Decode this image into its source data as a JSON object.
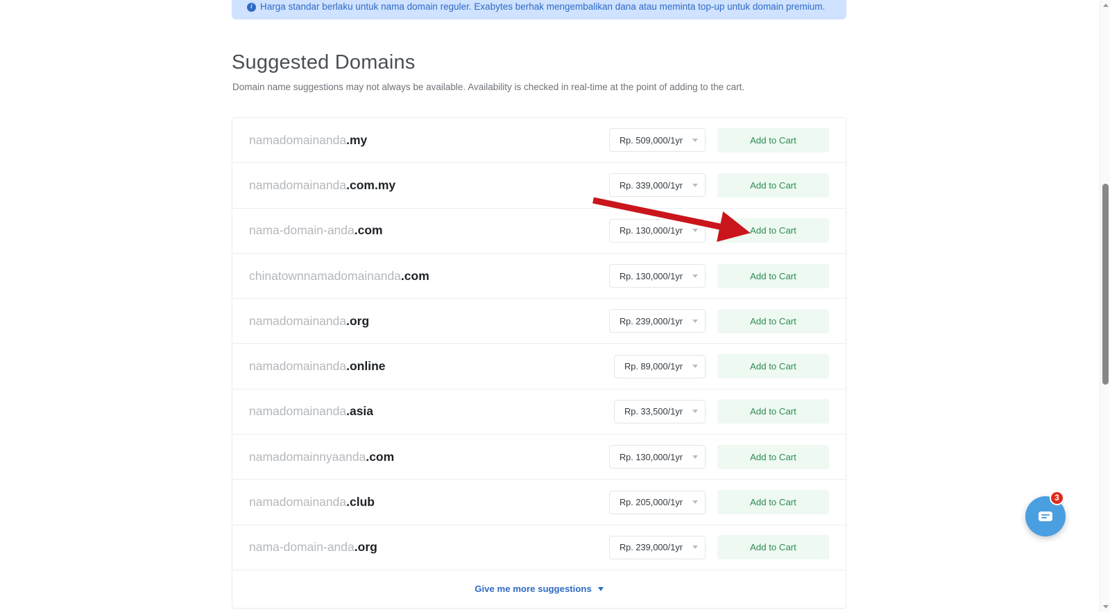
{
  "banner": {
    "icon": "info-circle-icon",
    "text": "Harga standar berlaku untuk nama domain reguler. Exabytes berhak mengembalikan dana atau meminta top-up untuk domain premium.",
    "background_color": "#cfe2ff",
    "text_color": "#2f6bc4"
  },
  "section": {
    "title": "Suggested Domains",
    "subtitle": "Domain name suggestions may not always be available. Availability is checked in real-time at the point of adding to the cart."
  },
  "domains": [
    {
      "sld": "namadomainanda",
      "tld": ".my",
      "price": "Rp. 509,000/1yr",
      "cart_label": "Add to Cart"
    },
    {
      "sld": "namadomainanda",
      "tld": ".com.my",
      "price": "Rp. 339,000/1yr",
      "cart_label": "Add to Cart"
    },
    {
      "sld": "nama-domain-anda",
      "tld": ".com",
      "price": "Rp. 130,000/1yr",
      "cart_label": "Add to Cart"
    },
    {
      "sld": "chinatownnamadomainanda",
      "tld": ".com",
      "price": "Rp. 130,000/1yr",
      "cart_label": "Add to Cart"
    },
    {
      "sld": "namadomainanda",
      "tld": ".org",
      "price": "Rp. 239,000/1yr",
      "cart_label": "Add to Cart"
    },
    {
      "sld": "namadomainanda",
      "tld": ".online",
      "price": "Rp. 89,000/1yr",
      "cart_label": "Add to Cart"
    },
    {
      "sld": "namadomainanda",
      "tld": ".asia",
      "price": "Rp. 33,500/1yr",
      "cart_label": "Add to Cart"
    },
    {
      "sld": "namadomainnyaanda",
      "tld": ".com",
      "price": "Rp. 130,000/1yr",
      "cart_label": "Add to Cart"
    },
    {
      "sld": "namadomainanda",
      "tld": ".club",
      "price": "Rp. 205,000/1yr",
      "cart_label": "Add to Cart"
    },
    {
      "sld": "nama-domain-anda",
      "tld": ".org",
      "price": "Rp. 239,000/1yr",
      "cart_label": "Add to Cart"
    }
  ],
  "more_suggestions": {
    "label": "Give me more suggestions",
    "icon": "chevron-down-icon",
    "color": "#2f6bc4"
  },
  "annotation": {
    "type": "red-arrow",
    "color": "#c9151b",
    "points_to": "Add to Cart"
  },
  "chat_widget": {
    "icon": "chat-bubble-icon",
    "badge_count": "3",
    "bubble_color": "#4a9fe0",
    "badge_color": "#e02b1d"
  },
  "scrollbar": {
    "up_icon": "scroll-up-arrow-icon",
    "down_icon": "scroll-down-arrow-icon"
  },
  "colors": {
    "cart_button_bg": "#eef9f2",
    "cart_button_text": "#2e8b51",
    "domain_sld": "#b4b8bc",
    "domain_tld": "#1d2125"
  }
}
